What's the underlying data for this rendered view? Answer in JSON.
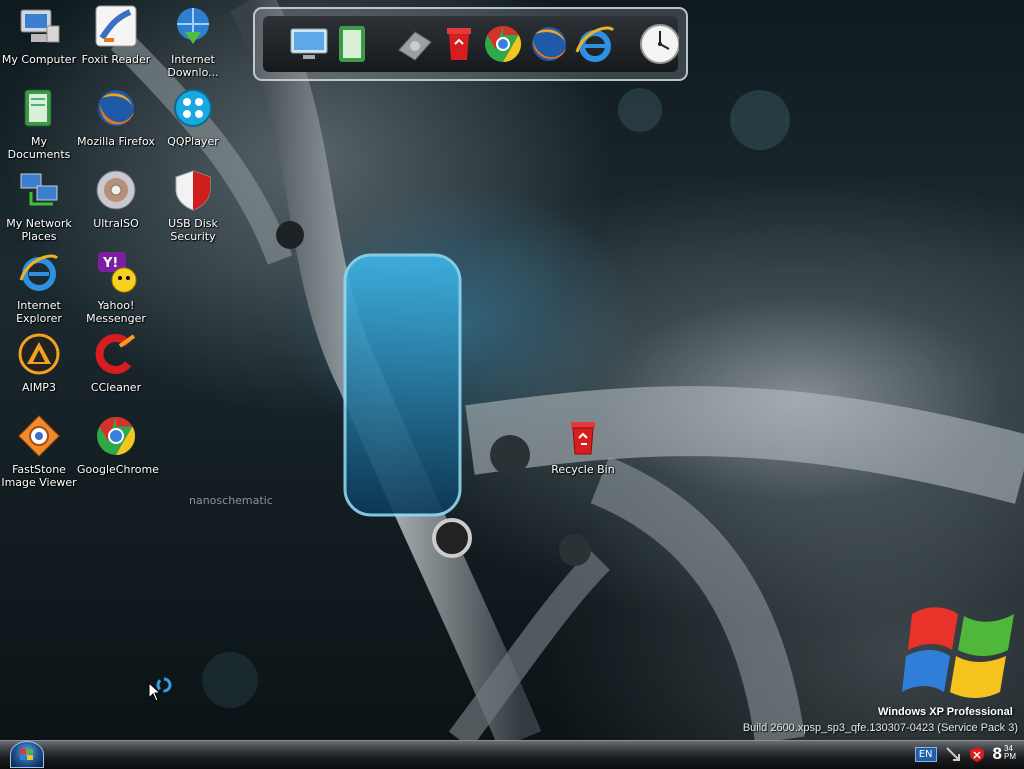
{
  "desktop": {
    "icons": [
      {
        "id": "my-computer",
        "label": "My Computer",
        "icon": "computer-icon"
      },
      {
        "id": "foxit-reader",
        "label": "Foxit Reader",
        "icon": "foxit-icon"
      },
      {
        "id": "internet-download",
        "label": "Internet Downlo...",
        "icon": "idm-icon"
      },
      {
        "id": "my-documents",
        "label": "My Documents",
        "icon": "documents-icon"
      },
      {
        "id": "mozilla-firefox",
        "label": "Mozilla Firefox",
        "icon": "firefox-icon"
      },
      {
        "id": "qqplayer",
        "label": "QQPlayer",
        "icon": "qqplayer-icon"
      },
      {
        "id": "my-network-places",
        "label": "My Network Places",
        "icon": "network-icon"
      },
      {
        "id": "ultraiso",
        "label": "UltraISO",
        "icon": "disc-icon"
      },
      {
        "id": "usb-disk-security",
        "label": "USB Disk Security",
        "icon": "shield-icon"
      },
      {
        "id": "internet-explorer",
        "label": "Internet Explorer",
        "icon": "ie-icon"
      },
      {
        "id": "yahoo-messenger",
        "label": "Yahoo! Messenger",
        "icon": "yahoo-icon"
      },
      {
        "id": "aimp3",
        "label": "AIMP3",
        "icon": "aimp-icon"
      },
      {
        "id": "ccleaner",
        "label": "CCleaner",
        "icon": "ccleaner-icon"
      },
      {
        "id": "faststone",
        "label": "FastStone Image Viewer",
        "icon": "faststone-icon"
      },
      {
        "id": "googlechrome",
        "label": "GoogleChrome",
        "icon": "chrome-icon"
      },
      {
        "id": "recycle-bin",
        "label": "Recycle Bin",
        "icon": "recycle-bin-icon"
      }
    ]
  },
  "dock": {
    "items": [
      "monitor-icon",
      "documents-icon",
      "drive-icon",
      "recycle-bin-icon",
      "chrome-icon",
      "firefox-icon",
      "ie-icon",
      "clock-icon"
    ]
  },
  "wallpaper_text": {
    "nano": "nanoschematic",
    "edition": "Windows XP Professional",
    "build": "Build 2600.xpsp_sp3_qfe.130307-0423 (Service Pack 3)"
  },
  "taskbar": {
    "language": "EN",
    "clock_hour": "8",
    "clock_minute": "34",
    "clock_ampm": "PM"
  }
}
